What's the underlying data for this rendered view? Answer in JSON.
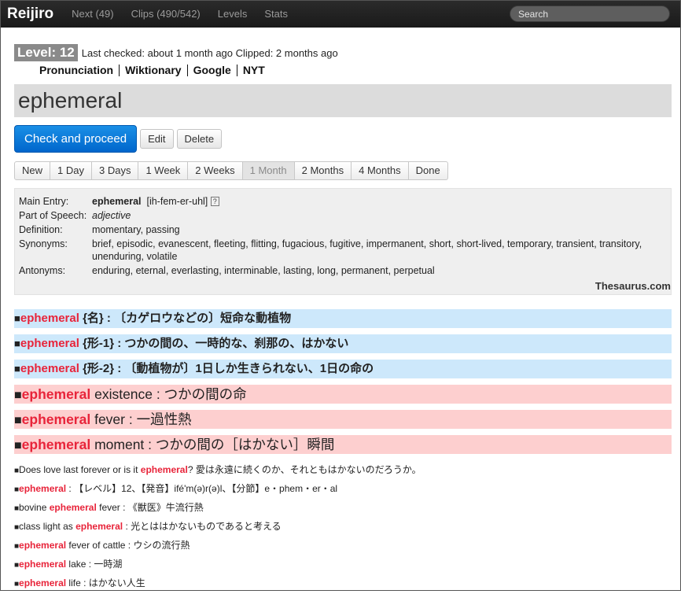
{
  "nav": {
    "brand": "Reijiro",
    "links": [
      "Next (49)",
      "Clips (490/542)",
      "Levels",
      "Stats"
    ],
    "search_placeholder": "Search"
  },
  "level": {
    "badge": "Level: 12",
    "meta": "Last checked: about 1 month ago Clipped: 2 months ago"
  },
  "ref_links": [
    "Pronunciation",
    "Wiktionary",
    "Google",
    "NYT"
  ],
  "word": "ephemeral",
  "actions": {
    "primary": "Check and proceed",
    "edit": "Edit",
    "delete": "Delete"
  },
  "intervals": {
    "items": [
      "New",
      "1 Day",
      "3 Days",
      "1 Week",
      "2 Weeks",
      "1 Month",
      "2 Months",
      "4 Months",
      "Done"
    ],
    "active_index": 5
  },
  "thesaurus": {
    "main_entry_label": "Main Entry:",
    "main_entry": "ephemeral",
    "pronunciation": "[ih-fem-er-uhl]",
    "help_icon": "?",
    "pos_label": "Part of Speech:",
    "pos": "adjective",
    "definition_label": "Definition:",
    "definition": "momentary, passing",
    "synonyms_label": "Synonyms:",
    "synonyms": "brief, episodic, evanescent, fleeting, flitting, fugacious, fugitive, impermanent, short, short-lived, temporary, transient, transitory, unenduring, volatile",
    "antonyms_label": "Antonyms:",
    "antonyms": "enduring, eternal, everlasting, interminable, lasting, long, permanent, perpetual",
    "credit": "Thesaurus.com"
  },
  "definitions": [
    {
      "style": "blue",
      "bullet": "■",
      "keyword": "ephemeral",
      "text": " {名} : 〔カゲロウなどの〕短命な動植物"
    },
    {
      "style": "blue",
      "bullet": "■",
      "keyword": "ephemeral",
      "text": " {形-1} : つかの間の、一時的な、刹那の、はかない"
    },
    {
      "style": "blue",
      "bullet": "■",
      "keyword": "ephemeral",
      "text": " {形-2} : 〔動植物が〕1日しか生きられない、1日の命の"
    },
    {
      "style": "pink",
      "bullet": "■",
      "keyword": "ephemeral",
      "text": " existence : つかの間の命"
    },
    {
      "style": "pink",
      "bullet": "■",
      "keyword": "ephemeral",
      "text": " fever : 一過性熱"
    },
    {
      "style": "pink",
      "bullet": "■",
      "keyword": "ephemeral",
      "text": " moment : つかの間の［はかない］瞬間"
    }
  ],
  "examples": [
    {
      "bullet": "■",
      "before": "Does love last forever or is it ",
      "keyword": "ephemeral",
      "after": "? 愛は永遠に続くのか、それともはかないのだろうか。"
    },
    {
      "bullet": "■",
      "before": "",
      "keyword": "ephemeral",
      "after": " : 【レベル】12、【発音】ifé'm(ə)r(ə)l、【分節】e・phem・er・al"
    },
    {
      "bullet": "■",
      "before": "bovine ",
      "keyword": "ephemeral",
      "after": " fever : 《獣医》牛流行熱"
    },
    {
      "bullet": "■",
      "before": "class light as ",
      "keyword": "ephemeral",
      "after": " : 光とははかないものであると考える"
    },
    {
      "bullet": "■",
      "before": "",
      "keyword": "ephemeral",
      "after": " fever of cattle : ウシの流行熱"
    },
    {
      "bullet": "■",
      "before": "",
      "keyword": "ephemeral",
      "after": " lake : 一時湖"
    },
    {
      "bullet": "■",
      "before": "",
      "keyword": "ephemeral",
      "after": " life : はかない人生"
    }
  ]
}
